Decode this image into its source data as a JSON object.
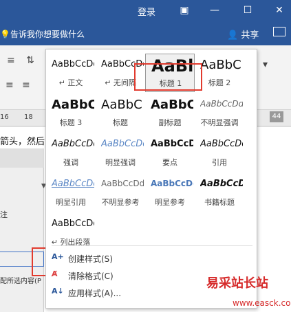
{
  "titlebar": {
    "login": "登录"
  },
  "tellme": {
    "placeholder": "告诉我你想要做什么",
    "share": "共享"
  },
  "doc": {
    "line1": "箭头，然后",
    "zhu": "注",
    "pastehint": "配所选内容(P"
  },
  "ruler": {
    "n1": "16",
    "n2": "18",
    "n3": "44"
  },
  "styles": [
    {
      "preview": "AaBbCcDd",
      "label": "↵ 正文"
    },
    {
      "preview": "AaBbCcDd",
      "label": "↵ 无间隔"
    },
    {
      "preview": "AaBl",
      "label": "标题 1"
    },
    {
      "preview": "AaBbC",
      "label": "标题 2"
    },
    {
      "preview": "AaBbC",
      "label": "标题 3"
    },
    {
      "preview": "AaBbC",
      "label": "标题"
    },
    {
      "preview": "AaBbC",
      "label": "副标题"
    },
    {
      "preview": "AaBbCcDd",
      "label": "不明显强调"
    },
    {
      "preview": "AaBbCcDd",
      "label": "强调"
    },
    {
      "preview": "AaBbCcDd",
      "label": "明显强调"
    },
    {
      "preview": "AaBbCcDd",
      "label": "要点"
    },
    {
      "preview": "AaBbCcDd",
      "label": "引用"
    },
    {
      "preview": "AaBbCcDd",
      "label": "明显引用"
    },
    {
      "preview": "AaBbCcDd",
      "label": "不明显参考"
    },
    {
      "preview": "AaBbCcDd",
      "label": "明显参考"
    },
    {
      "preview": "AaBbCcD",
      "label": "书籍标题"
    },
    {
      "preview": "AaBbCcDd",
      "label": "↵ 列出段落"
    }
  ],
  "menu": [
    {
      "label": "创建样式(S)"
    },
    {
      "label": "清除格式(C)"
    },
    {
      "label": "应用样式(A)..."
    }
  ],
  "watermark": {
    "cn": "易采站长站",
    "url": "www.easck.com"
  }
}
